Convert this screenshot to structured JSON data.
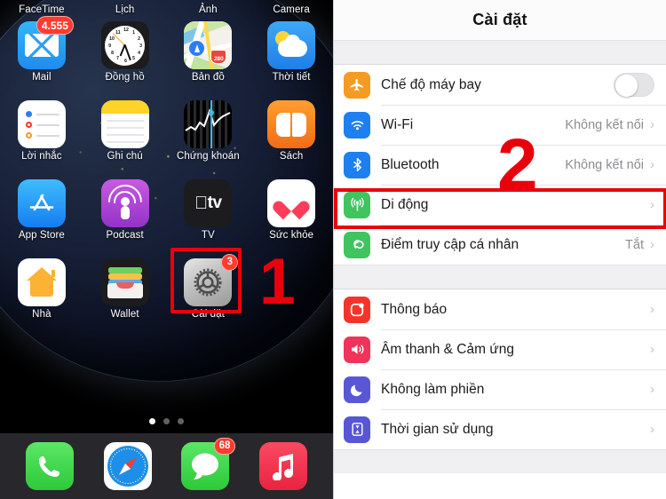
{
  "phone": {
    "wallpaper_name": "earth-night-wallpaper",
    "rows": [
      {
        "top_labels": [
          "FaceTime",
          "Lịch",
          "Ảnh",
          "Camera"
        ],
        "apps": [
          {
            "name": "Mail",
            "icon": "mail-icon",
            "badge": "4.555"
          },
          {
            "name": "Đồng hồ",
            "icon": "clock-icon",
            "badge": ""
          },
          {
            "name": "Bản đồ",
            "icon": "maps-icon",
            "badge": ""
          },
          {
            "name": "Thời tiết",
            "icon": "weather-icon",
            "badge": ""
          }
        ]
      },
      {
        "apps": [
          {
            "name": "Lời nhắc",
            "icon": "reminders-icon",
            "badge": ""
          },
          {
            "name": "Ghi chú",
            "icon": "notes-icon",
            "badge": ""
          },
          {
            "name": "Chứng khoán",
            "icon": "stocks-icon",
            "badge": ""
          },
          {
            "name": "Sách",
            "icon": "books-icon",
            "badge": ""
          }
        ]
      },
      {
        "apps": [
          {
            "name": "App Store",
            "icon": "app-store-icon",
            "badge": ""
          },
          {
            "name": "Podcast",
            "icon": "podcasts-icon",
            "badge": ""
          },
          {
            "name": "TV",
            "icon": "tv-icon",
            "badge": ""
          },
          {
            "name": "Sức khỏe",
            "icon": "health-icon",
            "badge": ""
          }
        ]
      },
      {
        "apps": [
          {
            "name": "Nhà",
            "icon": "home-icon",
            "badge": ""
          },
          {
            "name": "Wallet",
            "icon": "wallet-icon",
            "badge": ""
          },
          {
            "name": "Cài đặt",
            "icon": "settings-gear-icon",
            "badge": "3"
          },
          {
            "name": "",
            "icon": "",
            "badge": ""
          }
        ]
      }
    ],
    "dock": [
      {
        "name": "Điện thoại",
        "icon": "phone-icon",
        "badge": ""
      },
      {
        "name": "Safari",
        "icon": "safari-compass-icon",
        "badge": ""
      },
      {
        "name": "Tin nhắn",
        "icon": "messages-icon",
        "badge": "68"
      },
      {
        "name": "Nhạc",
        "icon": "music-note-icon",
        "badge": ""
      }
    ],
    "page_dots": {
      "count": 3,
      "active_index": 0
    },
    "maps_shield_label": "280",
    "tv_label": "tv"
  },
  "annotations": {
    "step1": {
      "number": "1",
      "target": "Cài đặt"
    },
    "step2": {
      "number": "2",
      "target": "Di động"
    },
    "accent_color": "#e8000d"
  },
  "settings": {
    "title": "Cài đặt",
    "groups": [
      {
        "rows": [
          {
            "label": "Chế độ máy bay",
            "icon": "airplane-icon",
            "icon_color": "#f59a23",
            "control": "toggle",
            "toggle_on": false,
            "value": "",
            "chevron": false
          },
          {
            "label": "Wi-Fi",
            "icon": "wifi-icon",
            "icon_color": "#1e7ff0",
            "control": "value",
            "value": "Không kết nối",
            "chevron": true
          },
          {
            "label": "Bluetooth",
            "icon": "bluetooth-icon",
            "icon_color": "#1e7ff0",
            "control": "value",
            "value": "Không kết nối",
            "chevron": true
          },
          {
            "label": "Di động",
            "icon": "cellular-antenna-icon",
            "icon_color": "#3fc45f",
            "control": "value",
            "value": "",
            "chevron": true,
            "highlighted": true
          },
          {
            "label": "Điểm truy cập cá nhân",
            "icon": "personal-hotspot-icon",
            "icon_color": "#3fc45f",
            "control": "value",
            "value": "Tắt",
            "chevron": true
          }
        ]
      },
      {
        "rows": [
          {
            "label": "Thông báo",
            "icon": "notifications-icon",
            "icon_color": "#f4342c",
            "control": "value",
            "value": "",
            "chevron": true
          },
          {
            "label": "Âm thanh & Cảm ứng",
            "icon": "sounds-haptics-icon",
            "icon_color": "#f1325a",
            "control": "value",
            "value": "",
            "chevron": true
          },
          {
            "label": "Không làm phiền",
            "icon": "do-not-disturb-moon-icon",
            "icon_color": "#5957d6",
            "control": "value",
            "value": "",
            "chevron": true
          },
          {
            "label": "Thời gian sử dụng",
            "icon": "screen-time-hourglass-icon",
            "icon_color": "#5756d5",
            "control": "value",
            "value": "",
            "chevron": true
          }
        ]
      }
    ]
  }
}
